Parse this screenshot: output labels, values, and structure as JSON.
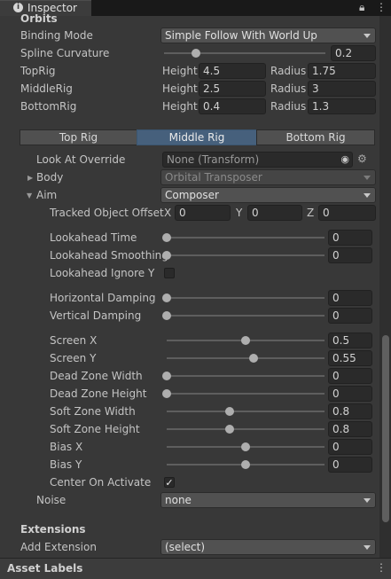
{
  "tab": {
    "title": "Inspector",
    "info_icon": "info-icon",
    "lock_icon": "lock-icon",
    "menu_icon": "kebab-menu-icon"
  },
  "orbits": {
    "header": "Orbits",
    "binding_mode_label": "Binding Mode",
    "binding_mode_value": "Simple Follow With World Up",
    "spline_curvature_label": "Spline Curvature",
    "spline_curvature_value": "0.2",
    "spline_curvature_fraction": 0.2,
    "rigs": [
      {
        "name": "TopRig",
        "height_label": "Height",
        "height": "4.5",
        "radius_label": "Radius",
        "radius": "1.75"
      },
      {
        "name": "MiddleRig",
        "height_label": "Height",
        "height": "2.5",
        "radius_label": "Radius",
        "radius": "3"
      },
      {
        "name": "BottomRig",
        "height_label": "Height",
        "height": "0.4",
        "radius_label": "Radius",
        "radius": "1.3"
      }
    ]
  },
  "rig_tabs": {
    "items": [
      "Top Rig",
      "Middle Rig",
      "Bottom Rig"
    ],
    "selected": "Middle Rig"
  },
  "middle_rig": {
    "look_at_label": "Look At Override",
    "look_at_value": "None (Transform)",
    "body_label": "Body",
    "body_value": "Orbital Transposer",
    "aim_label": "Aim",
    "aim_value": "Composer",
    "tracked_offset_label": "Tracked Object Offset",
    "offset": {
      "x_label": "X",
      "x": "0",
      "y_label": "Y",
      "y": "0",
      "z_label": "Z",
      "z": "0"
    },
    "lookahead_ignore_y_label": "Lookahead Ignore Y",
    "lookahead_ignore_y_checked": false,
    "sliders": [
      {
        "label": "Lookahead Time",
        "value": "0",
        "fraction": 0.0
      },
      {
        "label": "Lookahead Smoothing",
        "value": "0",
        "fraction": 0.0
      },
      {
        "label": "Horizontal Damping",
        "value": "0",
        "fraction": 0.0
      },
      {
        "label": "Vertical Damping",
        "value": "0",
        "fraction": 0.0
      },
      {
        "label": "Screen X",
        "value": "0.5",
        "fraction": 0.5
      },
      {
        "label": "Screen Y",
        "value": "0.55",
        "fraction": 0.55
      },
      {
        "label": "Dead Zone Width",
        "value": "0",
        "fraction": 0.0
      },
      {
        "label": "Dead Zone Height",
        "value": "0",
        "fraction": 0.0
      },
      {
        "label": "Soft Zone Width",
        "value": "0.8",
        "fraction": 0.4
      },
      {
        "label": "Soft Zone Height",
        "value": "0.8",
        "fraction": 0.4
      },
      {
        "label": "Bias X",
        "value": "0",
        "fraction": 0.5
      },
      {
        "label": "Bias Y",
        "value": "0",
        "fraction": 0.5
      }
    ],
    "center_on_activate_label": "Center On Activate",
    "center_on_activate_checked": true,
    "noise_label": "Noise",
    "noise_value": "none"
  },
  "extensions": {
    "header": "Extensions",
    "add_label": "Add Extension",
    "add_value": "(select)"
  },
  "asset_labels": "Asset Labels"
}
